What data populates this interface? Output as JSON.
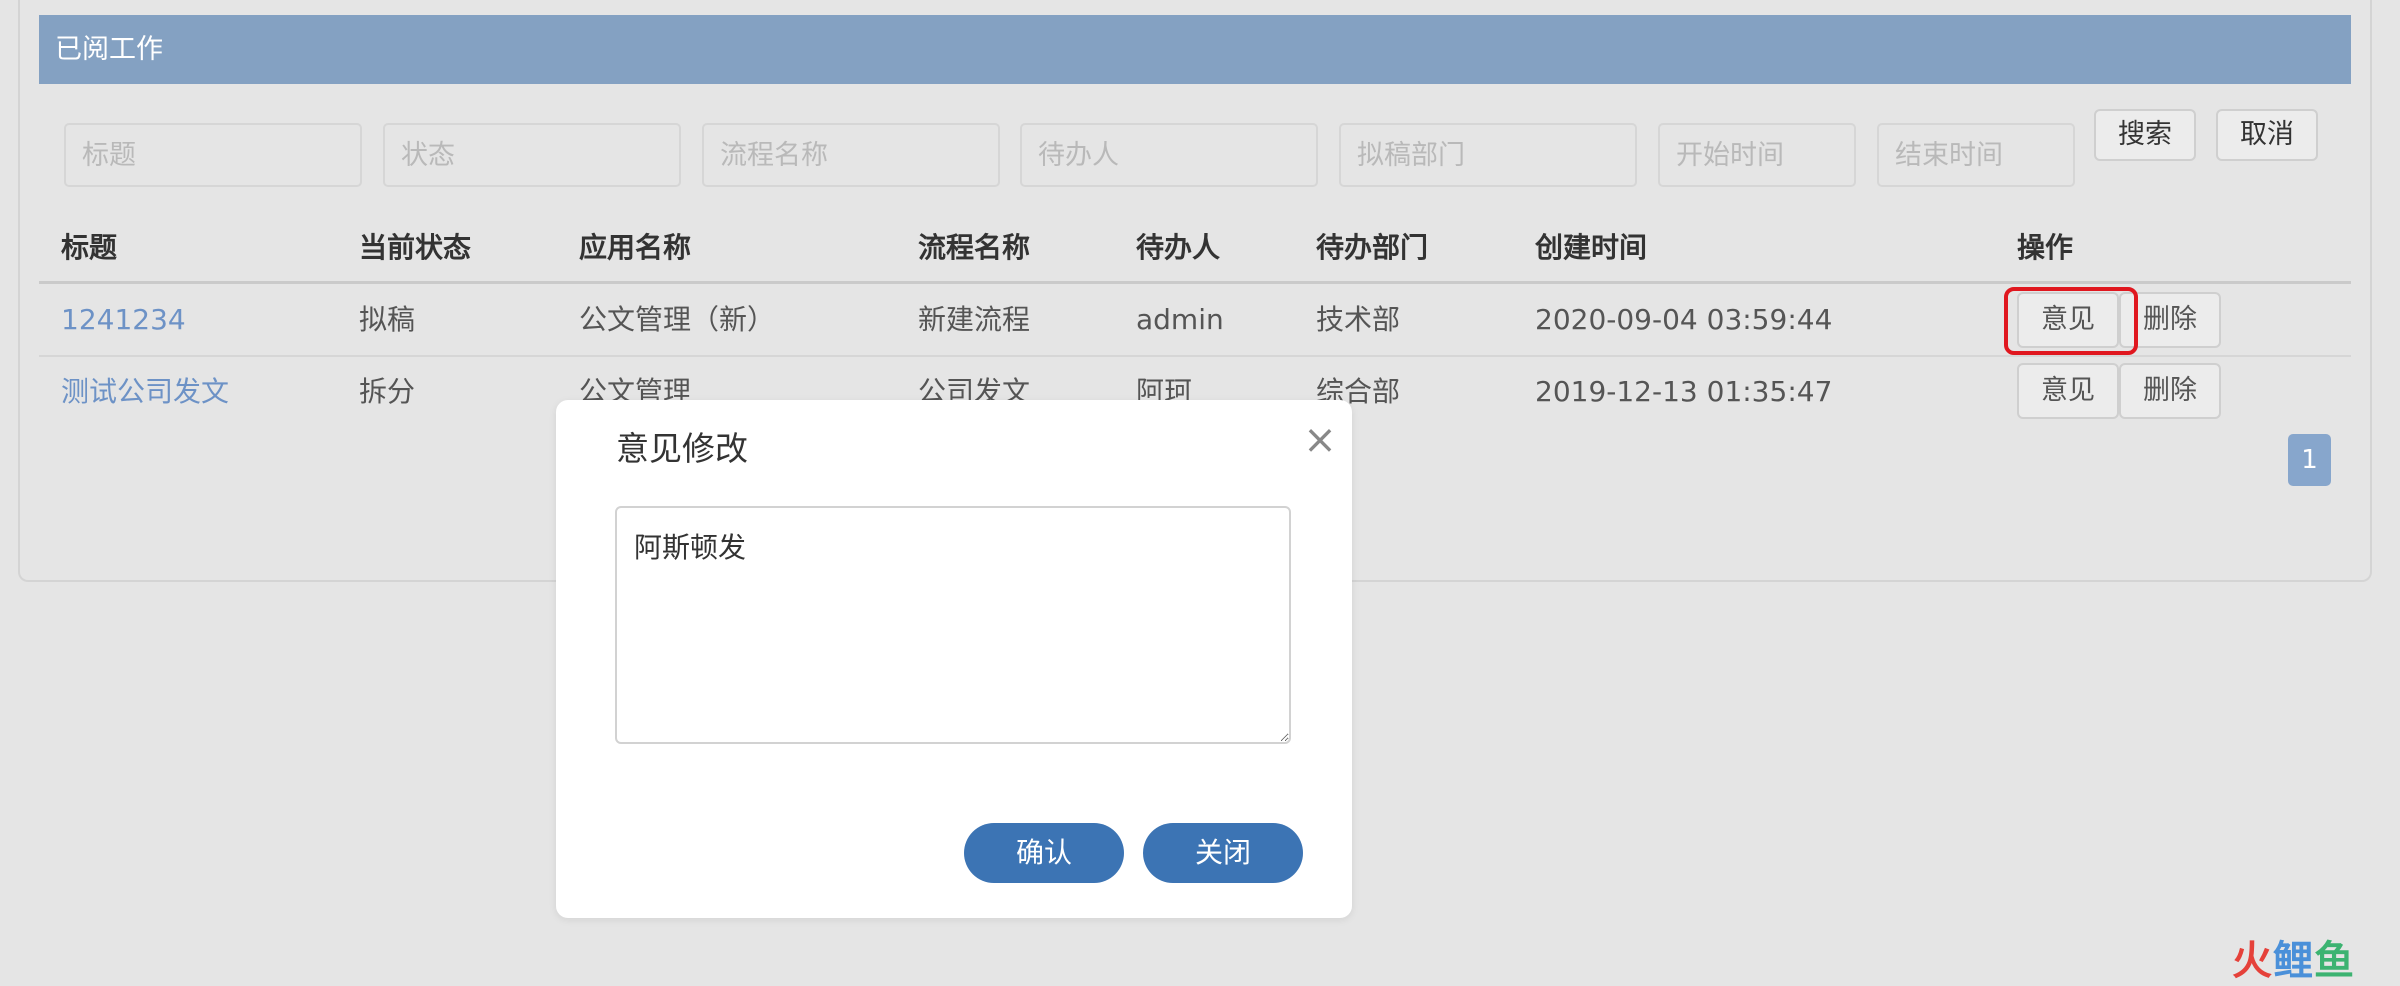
{
  "panel": {
    "title": "已阅工作"
  },
  "filters": {
    "title_placeholder": "标题",
    "status_placeholder": "状态",
    "flow_placeholder": "流程名称",
    "assignee_placeholder": "待办人",
    "dept_placeholder": "拟稿部门",
    "start_placeholder": "开始时间",
    "end_placeholder": "结束时间",
    "search_label": "搜索",
    "cancel_label": "取消"
  },
  "table": {
    "headers": [
      "标题",
      "当前状态",
      "应用名称",
      "流程名称",
      "待办人",
      "待办部门",
      "创建时间",
      "操作"
    ],
    "rows": [
      {
        "title": "1241234",
        "status": "拟稿",
        "app": "公文管理（新）",
        "flow": "新建流程",
        "assignee": "admin",
        "dept": "技术部",
        "created": "2020-09-04 03:59:44",
        "opinion": "意见",
        "delete": "删除"
      },
      {
        "title": "测试公司发文",
        "status": "拆分",
        "app": "公文管理",
        "flow": "公司发文",
        "assignee": "阿珂",
        "dept": "综合部",
        "created": "2019-12-13 01:35:47",
        "opinion": "意见",
        "delete": "删除"
      }
    ]
  },
  "pagination": {
    "current": "1"
  },
  "modal": {
    "title": "意见修改",
    "content": "阿斯顿发",
    "close_icon": "×",
    "confirm_label": "确认",
    "close_label": "关闭"
  },
  "watermark": {
    "part1": "火",
    "part2": "鲤",
    "part3": "鱼"
  },
  "colors": {
    "header": "#84a1c2",
    "link": "#6d92c6",
    "primary": "#3c74b4",
    "highlight": "#e0171f"
  }
}
